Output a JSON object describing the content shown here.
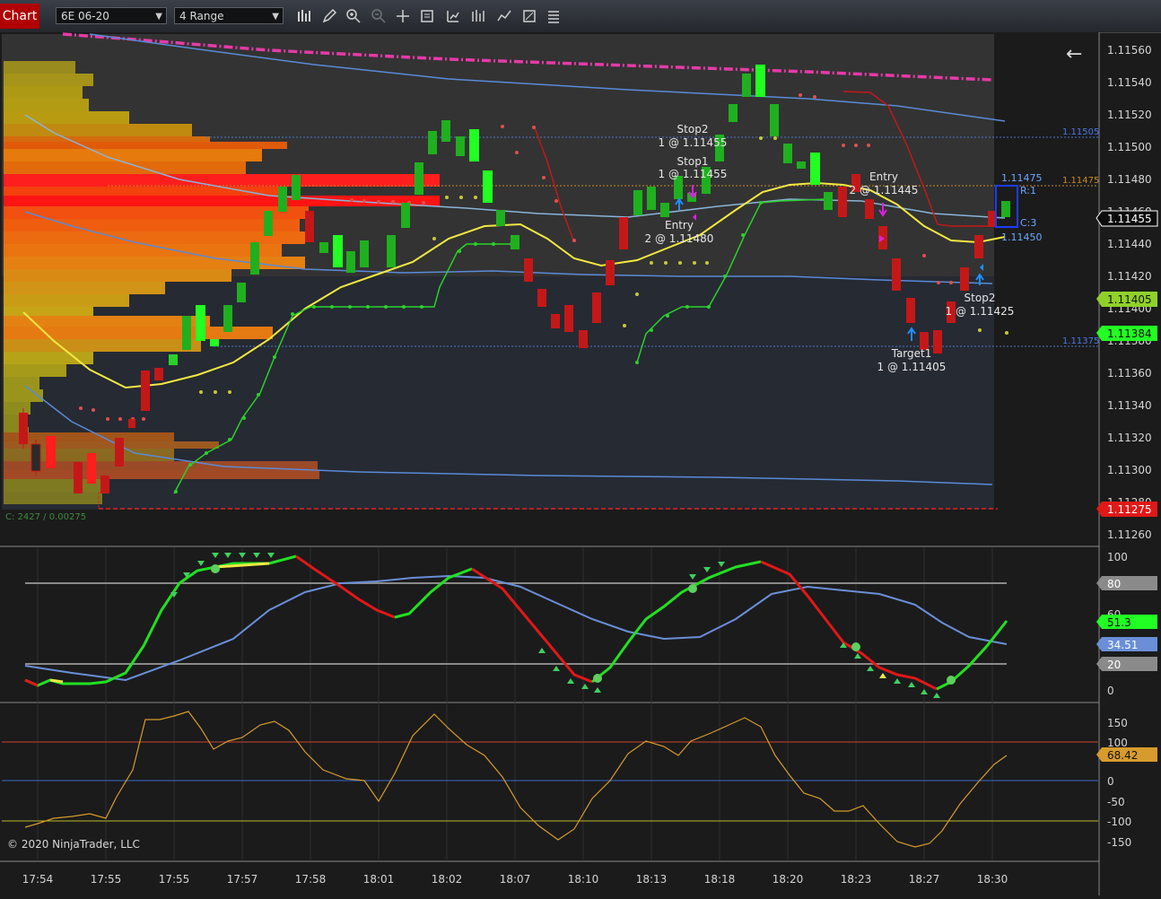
{
  "toolbar": {
    "chart_tab": "Chart",
    "instrument": "6E 06-20",
    "interval": "4 Range",
    "icons": [
      "bar-style-icon",
      "draw-pencil-icon",
      "zoom-in-icon",
      "zoom-out-icon",
      "crosshair-icon",
      "data-box-icon",
      "chart-properties-icon",
      "indicators-icon",
      "strategies-icon",
      "templates-icon"
    ]
  },
  "price_panel": {
    "y_axis": [
      "1.11560",
      "1.11540",
      "1.11520",
      "1.11500",
      "1.11480",
      "1.11460",
      "1.11440",
      "1.11420",
      "1.11400",
      "1.11380",
      "1.11360",
      "1.11340",
      "1.11320",
      "1.11300",
      "1.11280",
      "1.11260"
    ],
    "flags": {
      "last_price": "1.11455",
      "green_level": "1.11405",
      "green_level2": "1.11384",
      "red_level": "1.11275"
    },
    "line_labels": {
      "upper": "1.11505",
      "entry_line": "1.11475",
      "lower": "1.11375",
      "bar_high": "1.11475",
      "bar_close": "1.11450",
      "bar_r": "R:1",
      "bar_c": "C:3"
    },
    "annotations": {
      "stop2_a_title": "Stop2",
      "stop2_a_price": "1 @ 1.11455",
      "stop1_title": "Stop1",
      "stop1_price": "1 @ 1.11455",
      "entry_a_title": "Entry",
      "entry_a_price": "2 @ 1.11480",
      "entry_b_title": "Entry",
      "entry_b_price": "2 @ 1.11445",
      "stop2_b_title": "Stop2",
      "stop2_b_price": "1 @ 1.11425",
      "target1_title": "Target1",
      "target1_price": "1 @ 1.11405"
    },
    "profile_stat": "C: 2427 / 0.00275"
  },
  "osc1": {
    "y_axis": [
      "100",
      "80",
      "60",
      "40",
      "20",
      "0"
    ],
    "flags": {
      "level80": "80",
      "green": "51.3",
      "blue": "34.51",
      "level20": "20"
    }
  },
  "osc2": {
    "y_axis": [
      "150",
      "100",
      "50",
      "0",
      "-50",
      "-100",
      "-150"
    ],
    "flags": {
      "value": "68.42"
    }
  },
  "time_axis": [
    "17:54",
    "17:55",
    "17:55",
    "17:57",
    "17:58",
    "18:01",
    "18:02",
    "18:07",
    "18:10",
    "18:13",
    "18:18",
    "18:20",
    "18:23",
    "18:27",
    "18:30"
  ],
  "footer": {
    "copyright": "© 2020 NinjaTrader, LLC"
  },
  "colors": {
    "up": "#1fd31f",
    "down": "#c41818",
    "signal_yellow": "#f4e842",
    "cci": "#d79b2b"
  }
}
